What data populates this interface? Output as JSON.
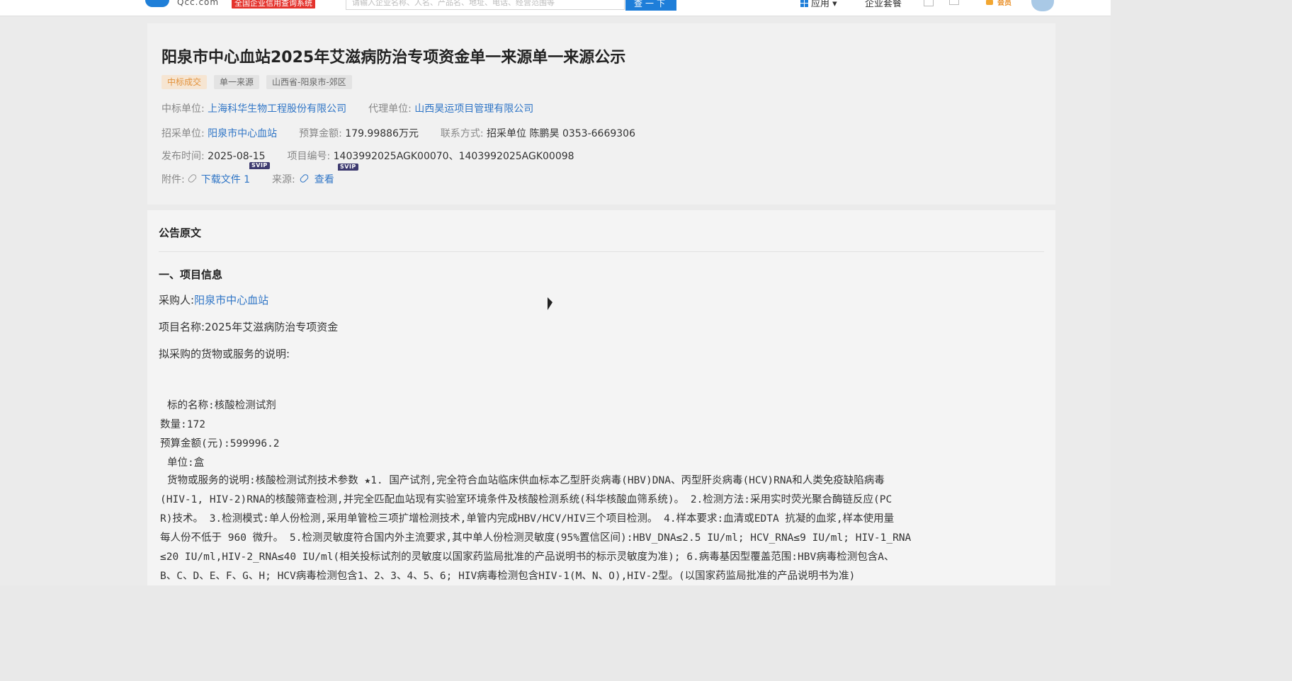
{
  "header": {
    "logo_text": "Qcc.com",
    "slogan": "全国企业信用查询系统",
    "search_placeholder": "请输入企业名称、人名、产品名、地址、电话、经营范围等",
    "search_button": "查一下",
    "nav_apps": "应用",
    "nav_enterprise": "企业套餐",
    "nav_vip": "会员"
  },
  "notice": {
    "title": "阳泉市中心血站2025年艾滋病防治专项资金单一来源单一来源公示",
    "tags": [
      "中标成交",
      "单一来源",
      "山西省-阳泉市-郊区"
    ],
    "winner_label": "中标单位:",
    "winner": "上海科华生物工程股份有限公司",
    "agent_label": "代理单位:",
    "agent": "山西昊运项目管理有限公司",
    "buyer_label": "招采单位:",
    "buyer": "阳泉市中心血站",
    "budget_label": "预算金额:",
    "budget": "179.99886万元",
    "contact_label": "联系方式:",
    "contact": "招采单位 陈鹏昊 0353-6669306",
    "publish_label": "发布时间:",
    "publish_date": "2025-08-15",
    "project_no_label": "项目编号:",
    "project_no": "1403992025AGK00070、1403992025AGK00098",
    "attachment_label": "附件:",
    "attachment_link": "下载文件 1",
    "source_label": "来源:",
    "source_link": "查看",
    "svip_badge": "SVIP"
  },
  "content": {
    "section_title": "公告原文",
    "heading": "一、项目信息",
    "buyer_line_label": "采购人:",
    "buyer_line_value": "阳泉市中心血站",
    "project_name": "项目名称:2025年艾滋病防治专项资金",
    "goods_desc_intro": "拟采购的货物或服务的说明:",
    "item_name": "标的名称:核酸检测试剂",
    "quantity": "数量:172",
    "budget_yuan": "预算金额(元):599996.2",
    "unit": "单位:盒",
    "desc_lines": [
      "货物或服务的说明:核酸检测试剂技术参数 ★1. 国产试剂,完全符合血站临床供血标本乙型肝炎病毒(HBV)DNA、丙型肝炎病毒(HCV)RNA和人类免疫缺陷病毒",
      "(HIV-1, HIV-2)RNA的核酸筛查检测,并完全匹配血站现有实验室环境条件及核酸检测系统(科华核酸血筛系统)。 2.检测方法:采用实时荧光聚合酶链反应(PC",
      "R)技术。 3.检测模式:单人份检测,采用单管检三项扩增检测技术,单管内完成HBV/HCV/HIV三个项目检测。 4.样本要求:血清或EDTA 抗凝的血浆,样本使用量",
      "每人份不低于 960 微升。 5.检测灵敏度符合国内外主流要求,其中单人份检测灵敏度(95%置信区间):HBV_DNA≤2.5 IU/ml; HCV_RNA≤9 IU/ml; HIV-1_RNA",
      "≤20 IU/ml,HIV-2_RNA≤40 IU/ml(相关投标试剂的灵敏度以国家药监局批准的产品说明书的标示灵敏度为准); 6.病毒基因型覆盖范围:HBV病毒检测包含A、",
      "B、C、D、E、F、G、H; HCV病毒检测包含1、2、3、4、5、6; HIV病毒检测包含HIV-1(M、N、O),HIV-2型。(以国家药监局批准的产品说明书为准)"
    ]
  },
  "colors": {
    "link": "#2f75c6",
    "brand_blue": "#1e7ed9",
    "slogan_red": "#e4332d",
    "tag_orange": "#e2923c"
  }
}
